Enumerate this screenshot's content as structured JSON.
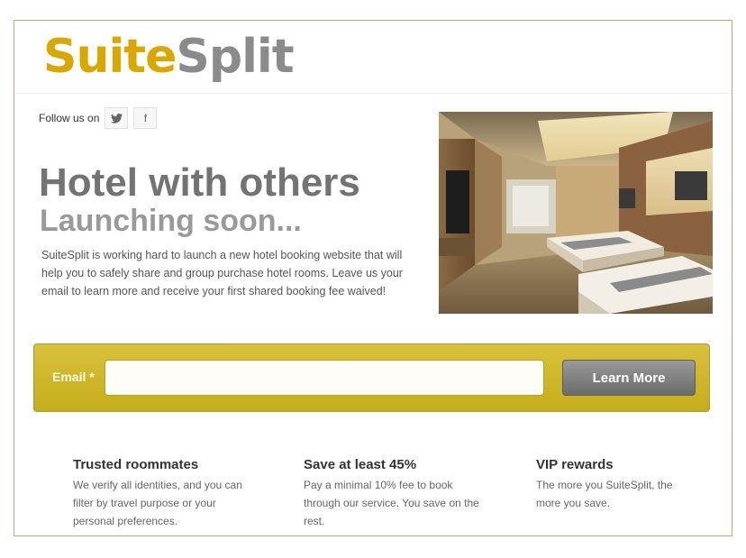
{
  "brand": {
    "logo_part1": "Suite",
    "logo_part2": "Split",
    "logo_color1": "#d9a800",
    "logo_color2": "#8b8b8b"
  },
  "social": {
    "follow_label": "Follow us on",
    "twitter_glyph": "🐦",
    "facebook_glyph": "f",
    "icons": [
      "twitter-icon",
      "facebook-icon"
    ]
  },
  "hero": {
    "headline": "Hotel with others",
    "subheadline": "Launching soon...",
    "description": "SuiteSplit is working hard to launch a new hotel booking website that will help you to safely share and group purchase hotel rooms. Leave us your email to learn more and receive your first shared booking fee waived!"
  },
  "signup": {
    "email_label": "Email *",
    "email_value": "",
    "email_placeholder": "",
    "button_label": "Learn More",
    "band_color": "#cdb728"
  },
  "features": [
    {
      "title": "Trusted roommates",
      "text": "We verify all identities, and you can filter by travel purpose or your personal preferences."
    },
    {
      "title": "Save at least 45%",
      "text": "Pay a minimal 10% fee to book through our service. You save on the rest."
    },
    {
      "title": "VIP rewards",
      "text": "The more you SuiteSplit, the more you save."
    }
  ]
}
